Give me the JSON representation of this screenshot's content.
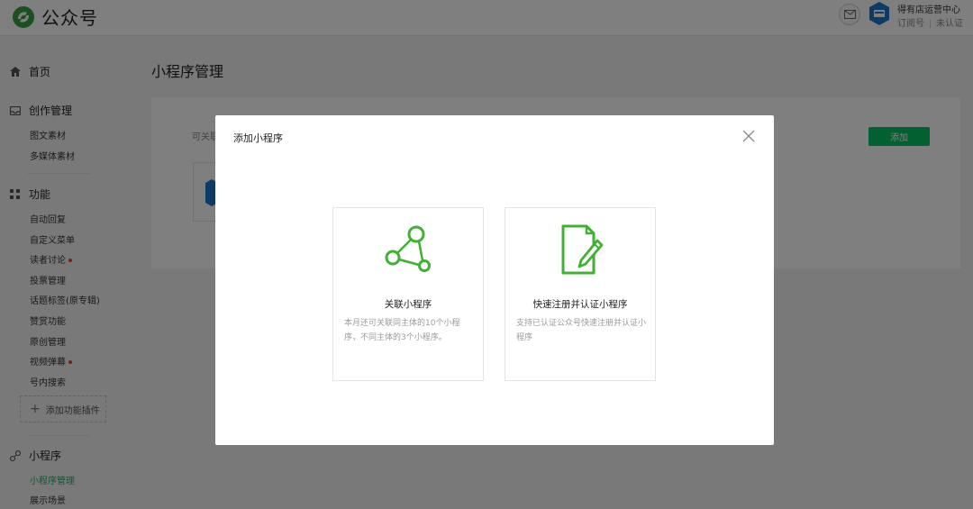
{
  "header": {
    "brand": "公众号",
    "account_name": "得有店运营中心",
    "account_type": "订阅号",
    "verification": "未认证"
  },
  "sidebar": {
    "home": "首页",
    "creation": {
      "label": "创作管理",
      "items": [
        "图文素材",
        "多媒体素材"
      ]
    },
    "features": {
      "label": "功能",
      "items": [
        "自动回复",
        "自定义菜单",
        "读者讨论",
        "投票管理",
        "话题标签(原专辑)",
        "赞赏功能",
        "原创管理",
        "视频弹幕",
        "号内搜索"
      ],
      "add_plugin": "添加功能插件"
    },
    "miniprogram": {
      "label": "小程序",
      "items": [
        "小程序管理",
        "展示场景"
      ]
    }
  },
  "main": {
    "title": "小程序管理",
    "desc_partial": "可关联",
    "add_button": "添加"
  },
  "modal": {
    "title": "添加小程序",
    "options": [
      {
        "icon": "share-nodes-icon",
        "title": "关联小程序",
        "desc": "本月还可关联同主体的10个小程序，不同主体的3个小程序。"
      },
      {
        "icon": "document-pen-icon",
        "title": "快速注册并认证小程序",
        "desc": "支持已认证公众号快速注册并认证小程序"
      }
    ]
  },
  "colors": {
    "accent": "#07c160",
    "notice_dot": "#e64340",
    "icon_green": "#41b035"
  }
}
